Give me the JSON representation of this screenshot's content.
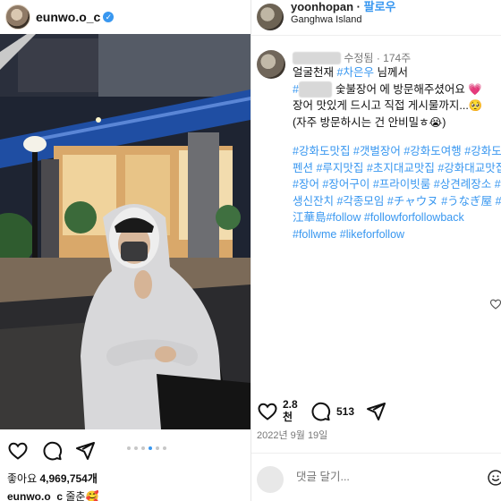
{
  "left_post": {
    "username": "eunwo.o_c",
    "verified_mark": "✓",
    "likes_label": "좋아요",
    "likes_count": "4,969,754개",
    "caption_user": "eunwo.o_c",
    "caption_text": "줄춘🥰",
    "carousel": {
      "total": 6,
      "active_index": 3
    }
  },
  "right_post": {
    "header_user": "yoonhopan",
    "follow_label": "팔로우",
    "location": "Ganghwa Island",
    "comment_meta": {
      "edited_label": "수정됨",
      "separator": "·",
      "age": "174주"
    },
    "caption_lines": {
      "line1_prefix": "얼굴천재",
      "line1_mention": "#차은우",
      "line1_suffix": "님께서",
      "line2_hash": "#",
      "line2_suffix": "숯불장어 에 방문해주셨어요",
      "line2_emoji": "💗",
      "line3": "장어 맛있게 드시고 직접 게시물까지...🥺",
      "line4": "(자주 방문하시는 건 안비밀ㅎ😭)"
    },
    "hashtags": "#강화도맛집 #갯벌장어 #강화도여행 #강화도펜션 #루지맛집 #초지대교맛집 #강화대교맛집 #장어 #장어구이 #프라이빗룸 #상견례장소 #생신잔치 #각종모임 #チャウヌ #うなぎ屋 #江華島#follow #followforfollowback #follwme #likeforfollow",
    "likes_count": "2.8\n천",
    "comments_count": "513",
    "date": "2022년 9월 19일",
    "comment_placeholder": "댓글 달기..."
  },
  "icons": {
    "like": "heart-icon",
    "comment": "comment-bubble-icon",
    "share": "paper-plane-icon",
    "emoji": "smiley-icon"
  },
  "colors": {
    "link_blue": "#3897f0",
    "text": "#111111",
    "muted": "#777777"
  }
}
